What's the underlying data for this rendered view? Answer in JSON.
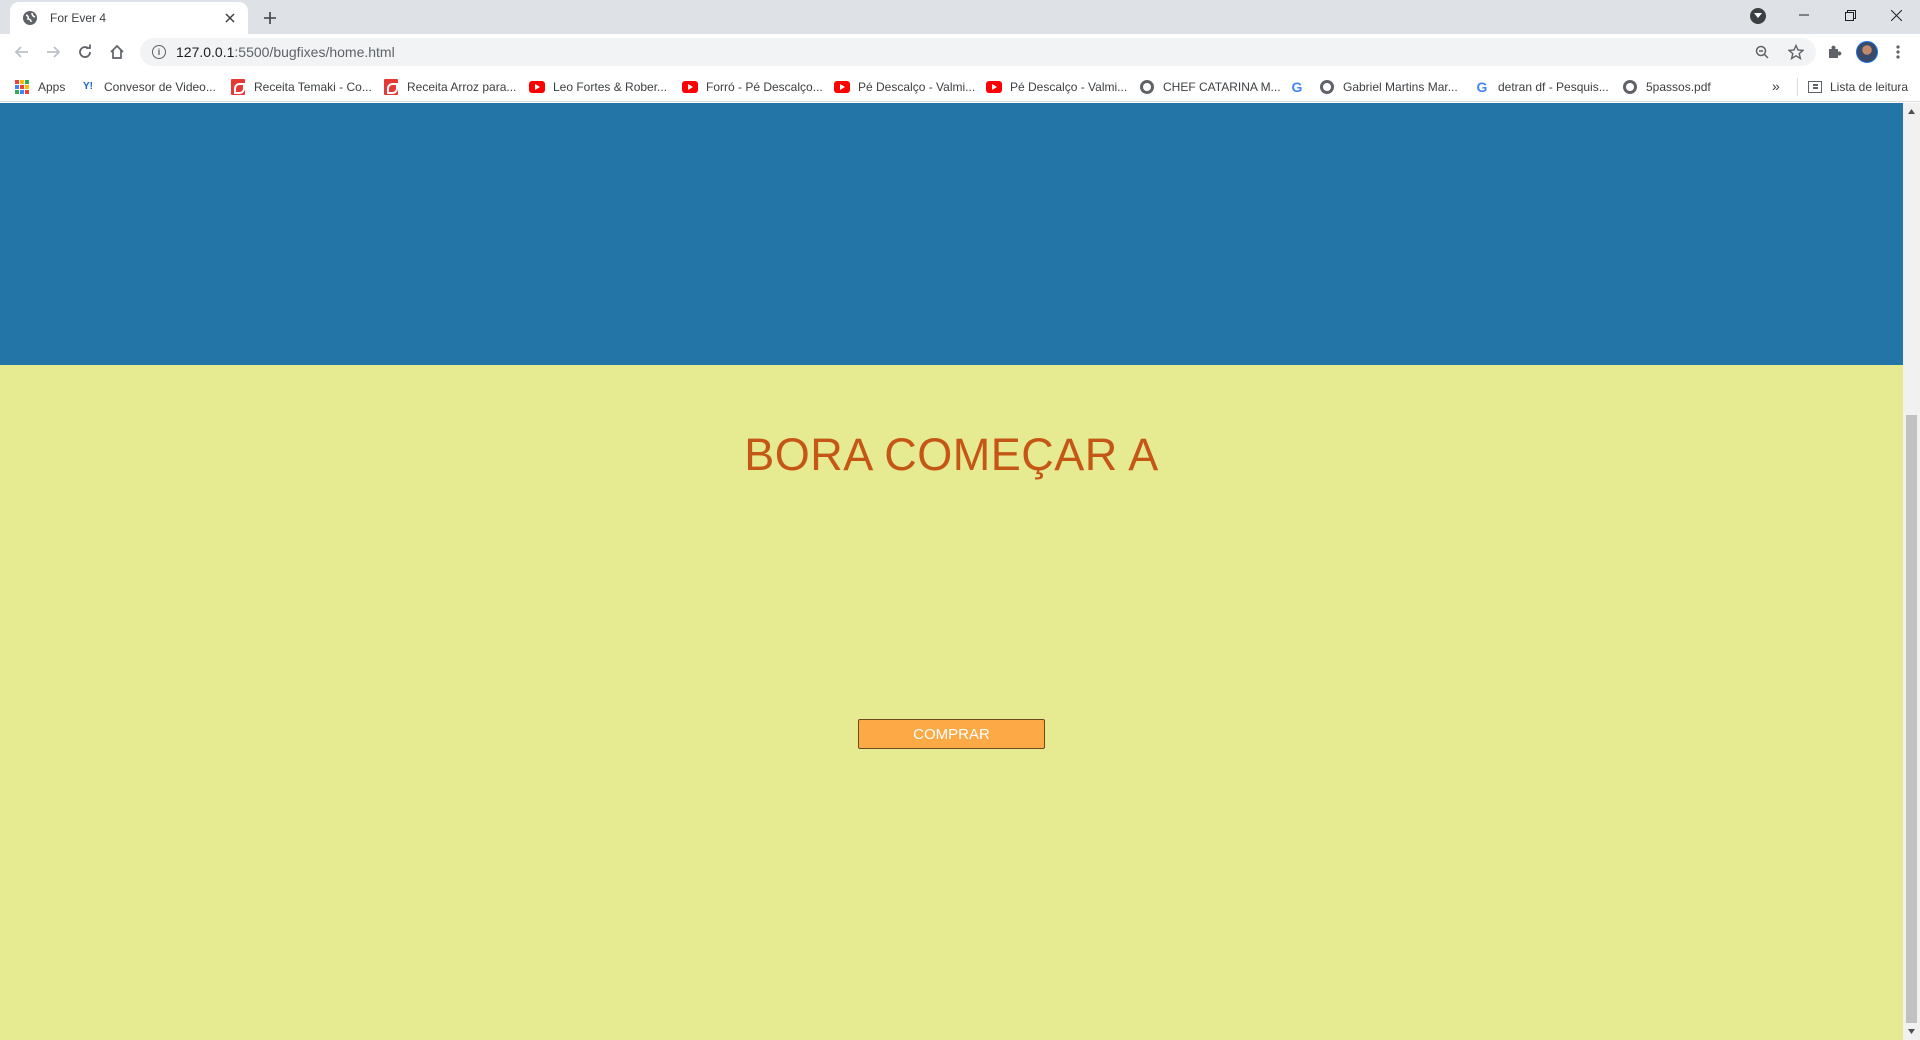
{
  "browser": {
    "tab_title": "For Ever 4",
    "url_host": "127.0.0.1",
    "url_rest": ":5500/bugfixes/home.html",
    "icons": {
      "back": "arrow-left-icon",
      "forward": "arrow-right-icon",
      "reload": "reload-icon",
      "home": "home-icon",
      "site_info": "info-icon",
      "zoom": "zoom-icon",
      "bookmark": "star-icon",
      "extensions": "puzzle-icon",
      "menu": "kebab-menu-icon"
    }
  },
  "bookmarks": {
    "items": [
      {
        "label": "Apps",
        "icon": "apps-grid-icon"
      },
      {
        "label": "Convesor de Video...",
        "icon": "yt-converter-icon"
      },
      {
        "label": "Receita Temaki - Co...",
        "icon": "pdf-icon"
      },
      {
        "label": "Receita Arroz para...",
        "icon": "pdf-icon"
      },
      {
        "label": "Leo Fortes & Rober...",
        "icon": "youtube-icon"
      },
      {
        "label": "Forró - Pé Descalço...",
        "icon": "youtube-icon"
      },
      {
        "label": "Pé Descalço - Valmi...",
        "icon": "youtube-icon"
      },
      {
        "label": "Pé Descalço - Valmi...",
        "icon": "youtube-icon"
      },
      {
        "label": "CHEF CATARINA M...",
        "icon": "globe-icon"
      },
      {
        "label": "",
        "icon": "google-icon"
      },
      {
        "label": "Gabriel Martins Mar...",
        "icon": "globe-icon"
      },
      {
        "label": "detran df - Pesquis...",
        "icon": "google-icon"
      },
      {
        "label": "5passos.pdf",
        "icon": "globe-icon"
      }
    ],
    "overflow": "»",
    "reading_list": "Lista de leitura"
  },
  "page": {
    "headline": "BORA COMEÇAR A",
    "buy_button": "COMPRAR",
    "colors": {
      "hero": "#2275a6",
      "section": "#e6ea90",
      "headline": "#c45716",
      "button": "#fca946"
    }
  }
}
